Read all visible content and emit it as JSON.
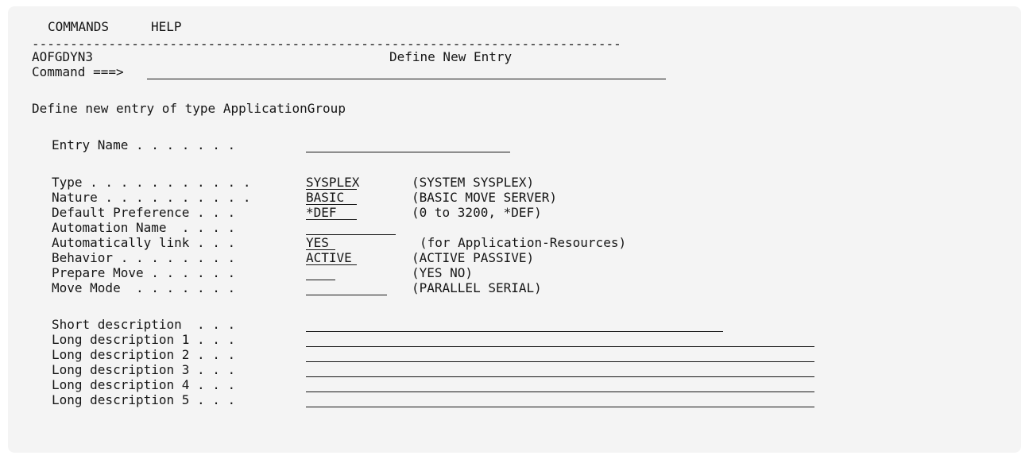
{
  "menu": {
    "commands": "COMMANDS",
    "help": "HELP"
  },
  "separator": "-----------------------------------------------------------------------------",
  "header": {
    "panel_id": "AOFGDYN3",
    "title": "Define New Entry"
  },
  "command": {
    "label": "Command ===>",
    "value": ""
  },
  "intro": "Define new entry of type ApplicationGroup",
  "fields": {
    "entry_name": {
      "label": "Entry Name . . . . . . .",
      "value": ""
    },
    "type": {
      "label": "Type . . . . . . . . . . .",
      "value": "SYSPLEX",
      "hint": "(SYSTEM SYSPLEX)"
    },
    "nature": {
      "label": "Nature . . . . . . . . . .",
      "value": "BASIC",
      "hint": "(BASIC MOVE SERVER)"
    },
    "default_preference": {
      "label": "Default Preference . . .",
      "value": "*DEF",
      "hint": "(0 to 3200, *DEF)"
    },
    "automation_name": {
      "label": "Automation Name  . . . .",
      "value": ""
    },
    "automatically_link": {
      "label": "Automatically link . . .",
      "value": "YES",
      "hint": "(for Application-Resources)"
    },
    "behavior": {
      "label": "Behavior . . . . . . . .",
      "value": "ACTIVE",
      "hint": "(ACTIVE PASSIVE)"
    },
    "prepare_move": {
      "label": "Prepare Move . . . . . .",
      "value": "",
      "hint": "(YES NO)"
    },
    "move_mode": {
      "label": "Move Mode  . . . . . . .",
      "value": "",
      "hint": "(PARALLEL SERIAL)"
    },
    "short_description": {
      "label": "Short description  . . .",
      "value": ""
    },
    "long_description_1": {
      "label": "Long description 1 . . .",
      "value": ""
    },
    "long_description_2": {
      "label": "Long description 2 . . .",
      "value": ""
    },
    "long_description_3": {
      "label": "Long description 3 . . .",
      "value": ""
    },
    "long_description_4": {
      "label": "Long description 4 . . .",
      "value": ""
    },
    "long_description_5": {
      "label": "Long description 5 . . .",
      "value": ""
    }
  }
}
